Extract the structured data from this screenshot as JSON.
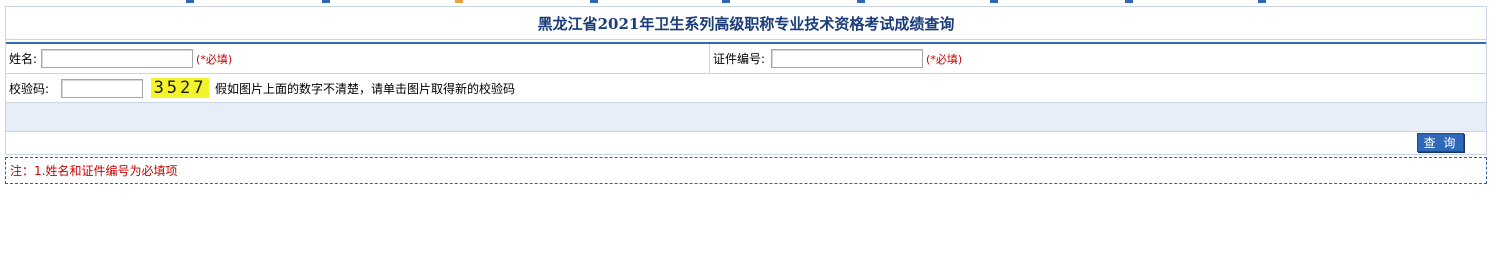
{
  "page": {
    "title": "黑龙江省2021年卫生系列高级职称专业技术资格考试成绩查询"
  },
  "form": {
    "name_label": "姓名:",
    "name_value": "",
    "name_required": "(*必填)",
    "id_label": "证件编号:",
    "id_value": "",
    "id_required": "(*必填)",
    "captcha_label": "校验码:",
    "captcha_value": "",
    "captcha_code": "3527",
    "captcha_hint": "假如图片上面的数字不清楚，请单击图片取得新的校验码",
    "submit_label": "查 询"
  },
  "note": {
    "text": "注：1.姓名和证件编号为必填项"
  },
  "colors": {
    "title": "#1a3c78",
    "accent": "#2f68b8",
    "required": "#cc0000",
    "captcha_bg": "#f3f32a",
    "band": "#e8eef7"
  }
}
